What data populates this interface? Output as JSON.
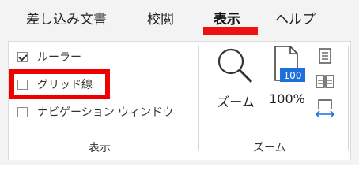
{
  "tabs": [
    {
      "label": "差し込み文書"
    },
    {
      "label": "校閲"
    },
    {
      "label": "表示",
      "active": true
    },
    {
      "label": "ヘルプ"
    }
  ],
  "show_group": {
    "label": "表示",
    "checkboxes": [
      {
        "label": "ルーラー",
        "checked": true
      },
      {
        "label": "グリッド線",
        "checked": false
      },
      {
        "label": "ナビゲーション ウィンドウ",
        "checked": false
      }
    ]
  },
  "zoom_group": {
    "label": "ズーム",
    "zoom_button_label": "ズーム",
    "hundred_button_label": "100%",
    "hundred_icon_text": "100"
  },
  "colors": {
    "highlight": "#ee0000",
    "accent_blue": "#1e6fd9",
    "tab_bar": "#f3f3f3"
  },
  "icons": [
    "checkmark-icon",
    "magnifier-icon",
    "page-100-icon",
    "one-page-icon",
    "multiple-pages-icon",
    "page-width-icon"
  ]
}
